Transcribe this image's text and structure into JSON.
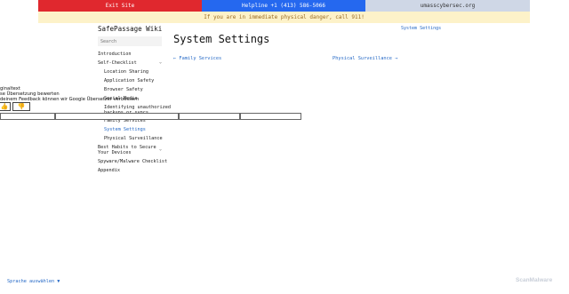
{
  "topbar": {
    "exit_label": "Exit Site",
    "helpline_label": " Helpline +1 (413) 586-5066",
    "site_label": "umasscybersec.org"
  },
  "banner": {
    "text": "If you are in immediate physical danger, call 911!"
  },
  "sidebar": {
    "title": "SafePassage Wiki",
    "search_placeholder": "Search",
    "items": [
      {
        "label": "Introduction"
      },
      {
        "label": "Self-Checklist",
        "chevron": "⌄"
      },
      {
        "label": "Location Sharing"
      },
      {
        "label": "Application Safety"
      },
      {
        "label": "Browser Safety"
      },
      {
        "label": "Social Media"
      },
      {
        "label": "Identifying unauthorized"
      },
      {
        "label": "backups or syncs"
      },
      {
        "label": "Family Services"
      },
      {
        "label": "System Settings"
      },
      {
        "label": "Physical Surveillance"
      },
      {
        "label": "Best Habits to Secure"
      },
      {
        "label": "Your Devices",
        "chevron": "⌄"
      },
      {
        "label": "Spyware/Malware Checklist"
      },
      {
        "label": "Appendix"
      }
    ]
  },
  "main": {
    "title": "System Settings",
    "breadcrumb": "System Settings",
    "prev_link": "← Family Services",
    "next_link": "Physical Surveillance →"
  },
  "translate_popup": {
    "line1": "ginaltext",
    "line2": "se Übersetzung bewerten",
    "line3": "deinem Feedback können wir Google Übersetzer verbessern",
    "thumb_up": "👍",
    "thumb_down": "👎"
  },
  "footer": {
    "language_link": "Sprache auswählen ▼",
    "scanmalware_text": "ScanMalware"
  },
  "colors": {
    "exit": "#e0282e",
    "helpline": "#2568ef",
    "site": "#cfd7e6",
    "banner_bg": "#fdf2c9",
    "link": "#2468c6"
  }
}
